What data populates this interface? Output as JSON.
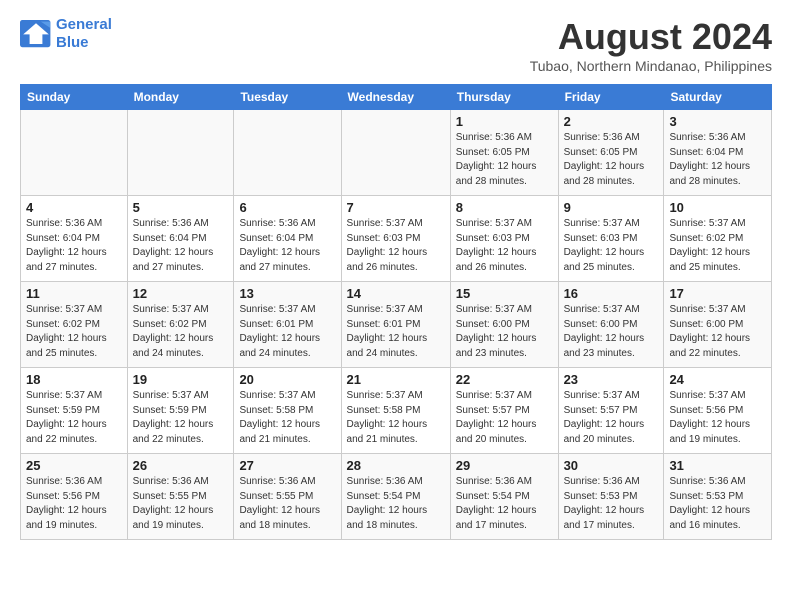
{
  "header": {
    "logo_line1": "General",
    "logo_line2": "Blue",
    "month_year": "August 2024",
    "location": "Tubao, Northern Mindanao, Philippines"
  },
  "days_of_week": [
    "Sunday",
    "Monday",
    "Tuesday",
    "Wednesday",
    "Thursday",
    "Friday",
    "Saturday"
  ],
  "weeks": [
    [
      {
        "day": "",
        "info": ""
      },
      {
        "day": "",
        "info": ""
      },
      {
        "day": "",
        "info": ""
      },
      {
        "day": "",
        "info": ""
      },
      {
        "day": "1",
        "info": "Sunrise: 5:36 AM\nSunset: 6:05 PM\nDaylight: 12 hours\nand 28 minutes."
      },
      {
        "day": "2",
        "info": "Sunrise: 5:36 AM\nSunset: 6:05 PM\nDaylight: 12 hours\nand 28 minutes."
      },
      {
        "day": "3",
        "info": "Sunrise: 5:36 AM\nSunset: 6:04 PM\nDaylight: 12 hours\nand 28 minutes."
      }
    ],
    [
      {
        "day": "4",
        "info": "Sunrise: 5:36 AM\nSunset: 6:04 PM\nDaylight: 12 hours\nand 27 minutes."
      },
      {
        "day": "5",
        "info": "Sunrise: 5:36 AM\nSunset: 6:04 PM\nDaylight: 12 hours\nand 27 minutes."
      },
      {
        "day": "6",
        "info": "Sunrise: 5:36 AM\nSunset: 6:04 PM\nDaylight: 12 hours\nand 27 minutes."
      },
      {
        "day": "7",
        "info": "Sunrise: 5:37 AM\nSunset: 6:03 PM\nDaylight: 12 hours\nand 26 minutes."
      },
      {
        "day": "8",
        "info": "Sunrise: 5:37 AM\nSunset: 6:03 PM\nDaylight: 12 hours\nand 26 minutes."
      },
      {
        "day": "9",
        "info": "Sunrise: 5:37 AM\nSunset: 6:03 PM\nDaylight: 12 hours\nand 25 minutes."
      },
      {
        "day": "10",
        "info": "Sunrise: 5:37 AM\nSunset: 6:02 PM\nDaylight: 12 hours\nand 25 minutes."
      }
    ],
    [
      {
        "day": "11",
        "info": "Sunrise: 5:37 AM\nSunset: 6:02 PM\nDaylight: 12 hours\nand 25 minutes."
      },
      {
        "day": "12",
        "info": "Sunrise: 5:37 AM\nSunset: 6:02 PM\nDaylight: 12 hours\nand 24 minutes."
      },
      {
        "day": "13",
        "info": "Sunrise: 5:37 AM\nSunset: 6:01 PM\nDaylight: 12 hours\nand 24 minutes."
      },
      {
        "day": "14",
        "info": "Sunrise: 5:37 AM\nSunset: 6:01 PM\nDaylight: 12 hours\nand 24 minutes."
      },
      {
        "day": "15",
        "info": "Sunrise: 5:37 AM\nSunset: 6:00 PM\nDaylight: 12 hours\nand 23 minutes."
      },
      {
        "day": "16",
        "info": "Sunrise: 5:37 AM\nSunset: 6:00 PM\nDaylight: 12 hours\nand 23 minutes."
      },
      {
        "day": "17",
        "info": "Sunrise: 5:37 AM\nSunset: 6:00 PM\nDaylight: 12 hours\nand 22 minutes."
      }
    ],
    [
      {
        "day": "18",
        "info": "Sunrise: 5:37 AM\nSunset: 5:59 PM\nDaylight: 12 hours\nand 22 minutes."
      },
      {
        "day": "19",
        "info": "Sunrise: 5:37 AM\nSunset: 5:59 PM\nDaylight: 12 hours\nand 22 minutes."
      },
      {
        "day": "20",
        "info": "Sunrise: 5:37 AM\nSunset: 5:58 PM\nDaylight: 12 hours\nand 21 minutes."
      },
      {
        "day": "21",
        "info": "Sunrise: 5:37 AM\nSunset: 5:58 PM\nDaylight: 12 hours\nand 21 minutes."
      },
      {
        "day": "22",
        "info": "Sunrise: 5:37 AM\nSunset: 5:57 PM\nDaylight: 12 hours\nand 20 minutes."
      },
      {
        "day": "23",
        "info": "Sunrise: 5:37 AM\nSunset: 5:57 PM\nDaylight: 12 hours\nand 20 minutes."
      },
      {
        "day": "24",
        "info": "Sunrise: 5:37 AM\nSunset: 5:56 PM\nDaylight: 12 hours\nand 19 minutes."
      }
    ],
    [
      {
        "day": "25",
        "info": "Sunrise: 5:36 AM\nSunset: 5:56 PM\nDaylight: 12 hours\nand 19 minutes."
      },
      {
        "day": "26",
        "info": "Sunrise: 5:36 AM\nSunset: 5:55 PM\nDaylight: 12 hours\nand 19 minutes."
      },
      {
        "day": "27",
        "info": "Sunrise: 5:36 AM\nSunset: 5:55 PM\nDaylight: 12 hours\nand 18 minutes."
      },
      {
        "day": "28",
        "info": "Sunrise: 5:36 AM\nSunset: 5:54 PM\nDaylight: 12 hours\nand 18 minutes."
      },
      {
        "day": "29",
        "info": "Sunrise: 5:36 AM\nSunset: 5:54 PM\nDaylight: 12 hours\nand 17 minutes."
      },
      {
        "day": "30",
        "info": "Sunrise: 5:36 AM\nSunset: 5:53 PM\nDaylight: 12 hours\nand 17 minutes."
      },
      {
        "day": "31",
        "info": "Sunrise: 5:36 AM\nSunset: 5:53 PM\nDaylight: 12 hours\nand 16 minutes."
      }
    ]
  ]
}
